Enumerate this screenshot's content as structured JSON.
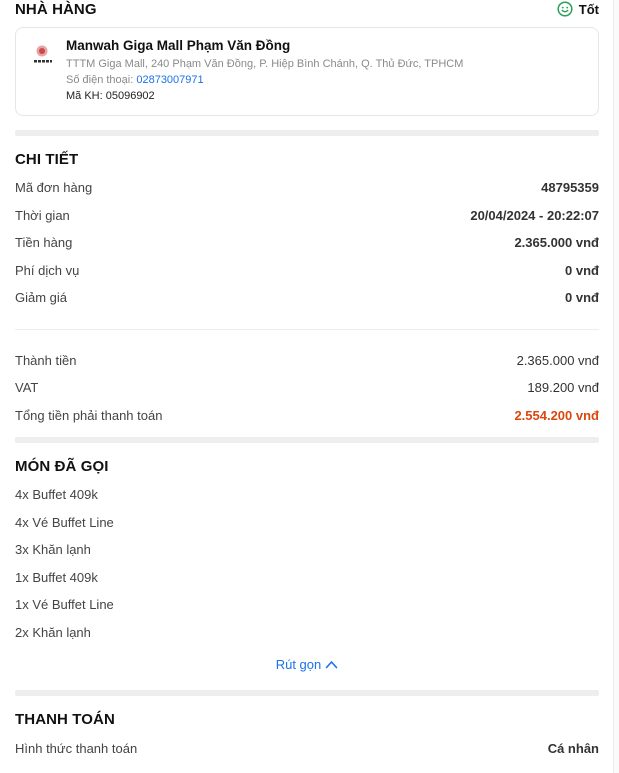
{
  "restaurant": {
    "section_title": "NHÀ HÀNG",
    "rating_label": "Tốt",
    "name": "Manwah Giga Mall Phạm Văn Đồng",
    "address": "TTTM Giga Mall, 240 Phạm Văn Đồng, P. Hiệp Bình Chánh, Q. Thủ Đức, TPHCM",
    "phone_label": "Số điện thoại:",
    "phone": "02873007971",
    "customer_code": "Mã KH: 05096902"
  },
  "details": {
    "section_title": "CHI TIẾT",
    "rows": [
      {
        "label": "Mã đơn hàng",
        "value": "48795359"
      },
      {
        "label": "Thời gian",
        "value": "20/04/2024 - 20:22:07"
      },
      {
        "label": "Tiền hàng",
        "value": "2.365.000 vnđ"
      },
      {
        "label": "Phí dịch vụ",
        "value": "0 vnđ"
      },
      {
        "label": "Giảm giá",
        "value": "0 vnđ"
      }
    ],
    "summary": [
      {
        "label": "Thành tiền",
        "value": "2.365.000 vnđ"
      },
      {
        "label": "VAT",
        "value": "189.200 vnđ"
      },
      {
        "label": "Tổng tiền phải thanh toán",
        "value": "2.554.200 vnđ"
      }
    ]
  },
  "ordered": {
    "section_title": "MÓN ĐÃ GỌI",
    "items": [
      "4x Buffet 409k",
      "4x Vé Buffet Line",
      "3x Khăn lạnh",
      "1x Buffet 409k",
      "1x Vé Buffet Line",
      "2x Khăn lạnh"
    ],
    "collapse_label": "Rút gọn"
  },
  "payment": {
    "section_title": "THANH TOÁN",
    "method_label": "Hình thức thanh toán",
    "method_value": "Cá nhân"
  },
  "colors": {
    "accent": "#1a73e8",
    "total": "#d9480f",
    "rating": "#2e9e5b"
  },
  "icons": {
    "rating": "smile-icon",
    "collapse": "chevron-up-icon",
    "logo": "restaurant-logo"
  }
}
